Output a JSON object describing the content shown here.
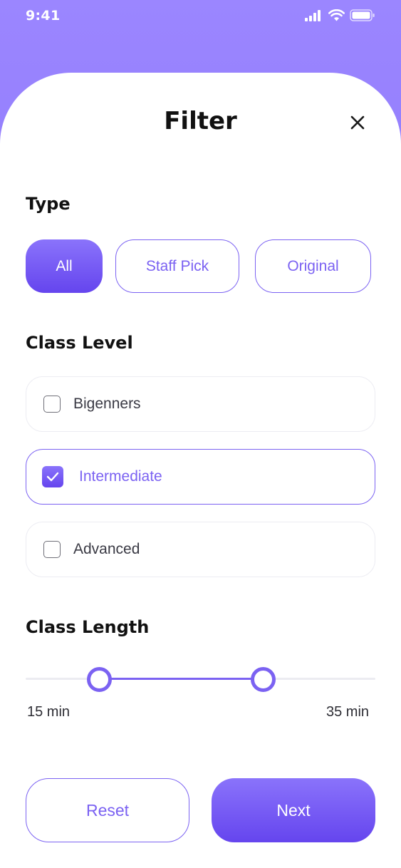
{
  "status_bar": {
    "time": "9:41"
  },
  "header": {
    "title": "Filter"
  },
  "type_section": {
    "title": "Type",
    "options": [
      {
        "label": "All",
        "selected": true
      },
      {
        "label": "Staff Pick",
        "selected": false
      },
      {
        "label": "Original",
        "selected": false
      }
    ]
  },
  "level_section": {
    "title": "Class Level",
    "options": [
      {
        "label": "Bigenners",
        "checked": false
      },
      {
        "label": "Intermediate",
        "checked": true
      },
      {
        "label": "Advanced",
        "checked": false
      }
    ]
  },
  "length_section": {
    "title": "Class Length",
    "min_label": "15 min",
    "max_label": "35 min"
  },
  "actions": {
    "reset_label": "Reset",
    "next_label": "Next"
  },
  "icons": [
    "signal-icon",
    "wifi-icon",
    "battery-icon",
    "close-icon",
    "check-icon"
  ],
  "colors": {
    "accent": "#7b62f2",
    "header_gradient_top": "#9b86ff",
    "header_gradient_bottom": "#7a62f5"
  }
}
